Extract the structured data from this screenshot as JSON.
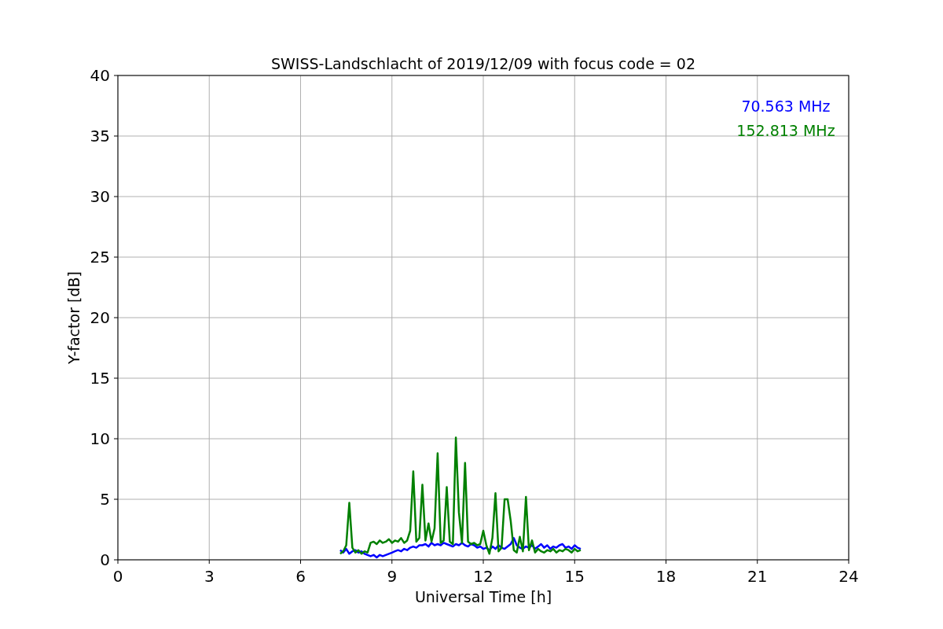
{
  "chart_data": {
    "type": "line",
    "title": "SWISS-Landschlacht of 2019/12/09 with focus code = 02",
    "xlabel": "Universal Time [h]",
    "ylabel": "Y-factor [dB]",
    "x": [
      7.3,
      7.4,
      7.5,
      7.6,
      7.7,
      7.8,
      7.9,
      8.0,
      8.1,
      8.2,
      8.3,
      8.4,
      8.5,
      8.6,
      8.7,
      8.8,
      8.9,
      9.0,
      9.1,
      9.2,
      9.3,
      9.4,
      9.5,
      9.6,
      9.7,
      9.8,
      9.9,
      10.0,
      10.1,
      10.2,
      10.3,
      10.4,
      10.5,
      10.6,
      10.7,
      10.8,
      10.9,
      11.0,
      11.1,
      11.2,
      11.3,
      11.4,
      11.5,
      11.6,
      11.7,
      11.8,
      11.9,
      12.0,
      12.1,
      12.2,
      12.3,
      12.4,
      12.5,
      12.6,
      12.7,
      12.8,
      12.9,
      13.0,
      13.1,
      13.2,
      13.3,
      13.4,
      13.5,
      13.6,
      13.7,
      13.8,
      13.9,
      14.0,
      14.1,
      14.2,
      14.3,
      14.4,
      14.5,
      14.6,
      14.7,
      14.8,
      14.9,
      15.0,
      15.1,
      15.2
    ],
    "series": [
      {
        "name": "70.563 MHz",
        "color": "#0000ff",
        "values": [
          0.8,
          0.6,
          0.9,
          0.5,
          0.7,
          0.8,
          0.6,
          0.7,
          0.5,
          0.4,
          0.3,
          0.4,
          0.2,
          0.4,
          0.3,
          0.4,
          0.5,
          0.6,
          0.7,
          0.8,
          0.7,
          0.9,
          0.8,
          1.0,
          1.1,
          1.0,
          1.2,
          1.2,
          1.3,
          1.1,
          1.4,
          1.2,
          1.3,
          1.2,
          1.4,
          1.3,
          1.2,
          1.1,
          1.3,
          1.2,
          1.4,
          1.2,
          1.1,
          1.3,
          1.2,
          1.0,
          1.1,
          0.9,
          1.0,
          0.8,
          1.1,
          0.9,
          1.2,
          1.0,
          0.9,
          1.1,
          1.3,
          1.8,
          1.2,
          1.0,
          0.9,
          1.1,
          1.0,
          1.2,
          0.9,
          1.1,
          1.3,
          1.0,
          1.2,
          0.9,
          1.1,
          1.0,
          1.2,
          1.3,
          1.0,
          1.1,
          0.9,
          1.2,
          1.0,
          0.9
        ]
      },
      {
        "name": "152.813 MHz",
        "color": "#008000",
        "values": [
          0.5,
          0.7,
          1.2,
          4.7,
          1.0,
          0.6,
          0.8,
          0.5,
          0.7,
          0.6,
          1.4,
          1.5,
          1.3,
          1.6,
          1.4,
          1.5,
          1.7,
          1.4,
          1.6,
          1.5,
          1.8,
          1.4,
          1.6,
          2.4,
          7.3,
          1.5,
          1.8,
          6.2,
          1.6,
          3.0,
          1.5,
          2.6,
          8.8,
          1.4,
          1.6,
          6.0,
          1.5,
          1.3,
          10.1,
          3.9,
          1.4,
          8.0,
          1.5,
          1.3,
          1.4,
          1.2,
          1.3,
          2.4,
          1.2,
          0.5,
          1.8,
          5.5,
          0.7,
          1.0,
          5.0,
          5.0,
          3.2,
          0.8,
          0.6,
          1.9,
          0.7,
          5.2,
          0.8,
          1.6,
          0.6,
          0.9,
          0.7,
          0.6,
          0.8,
          0.7,
          0.9,
          0.6,
          0.8,
          0.7,
          0.9,
          0.8,
          0.6,
          0.9,
          0.7,
          0.8
        ]
      }
    ],
    "xlim": [
      0,
      24
    ],
    "ylim": [
      0,
      40
    ],
    "xticks": [
      0,
      3,
      6,
      9,
      12,
      15,
      18,
      21,
      24
    ],
    "yticks": [
      0,
      5,
      10,
      15,
      20,
      25,
      30,
      35,
      40
    ],
    "grid": true
  }
}
